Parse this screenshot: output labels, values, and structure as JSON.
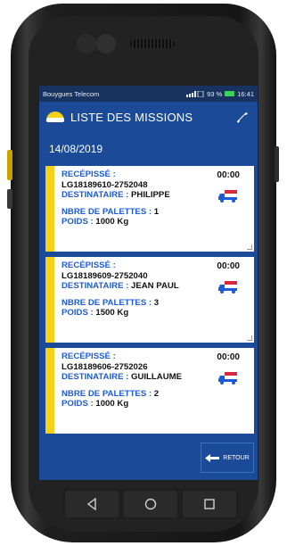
{
  "statusbar": {
    "carrier": "Bouygues Telecom",
    "battery": "93 %",
    "time": "16:41"
  },
  "appbar": {
    "title": "LISTE DES MISSIONS"
  },
  "date": "14/08/2019",
  "labels": {
    "recepisse": "RECÉPISSÉ :",
    "destinataire": "DESTINATAIRE :",
    "palettes": "NBRE DE PALETTES :",
    "poids": "POIDS :"
  },
  "missions": [
    {
      "recepisse": "LG18189610-2752048",
      "destinataire": "PHILIPPE",
      "palettes": "1",
      "poids": "1000 Kg",
      "time": "00:00"
    },
    {
      "recepisse": "LG18189609-2752040",
      "destinataire": "JEAN PAUL",
      "palettes": "3",
      "poids": "1500 Kg",
      "time": "00:00"
    },
    {
      "recepisse": "LG18189606-2752026",
      "destinataire": "GUILLAUME",
      "palettes": "2",
      "poids": "1000 Kg",
      "time": "00:00"
    }
  ],
  "retour_label": "RETOUR",
  "colors": {
    "primary": "#1b4a98",
    "accent": "#f4d21a",
    "label": "#1d5bd6"
  }
}
